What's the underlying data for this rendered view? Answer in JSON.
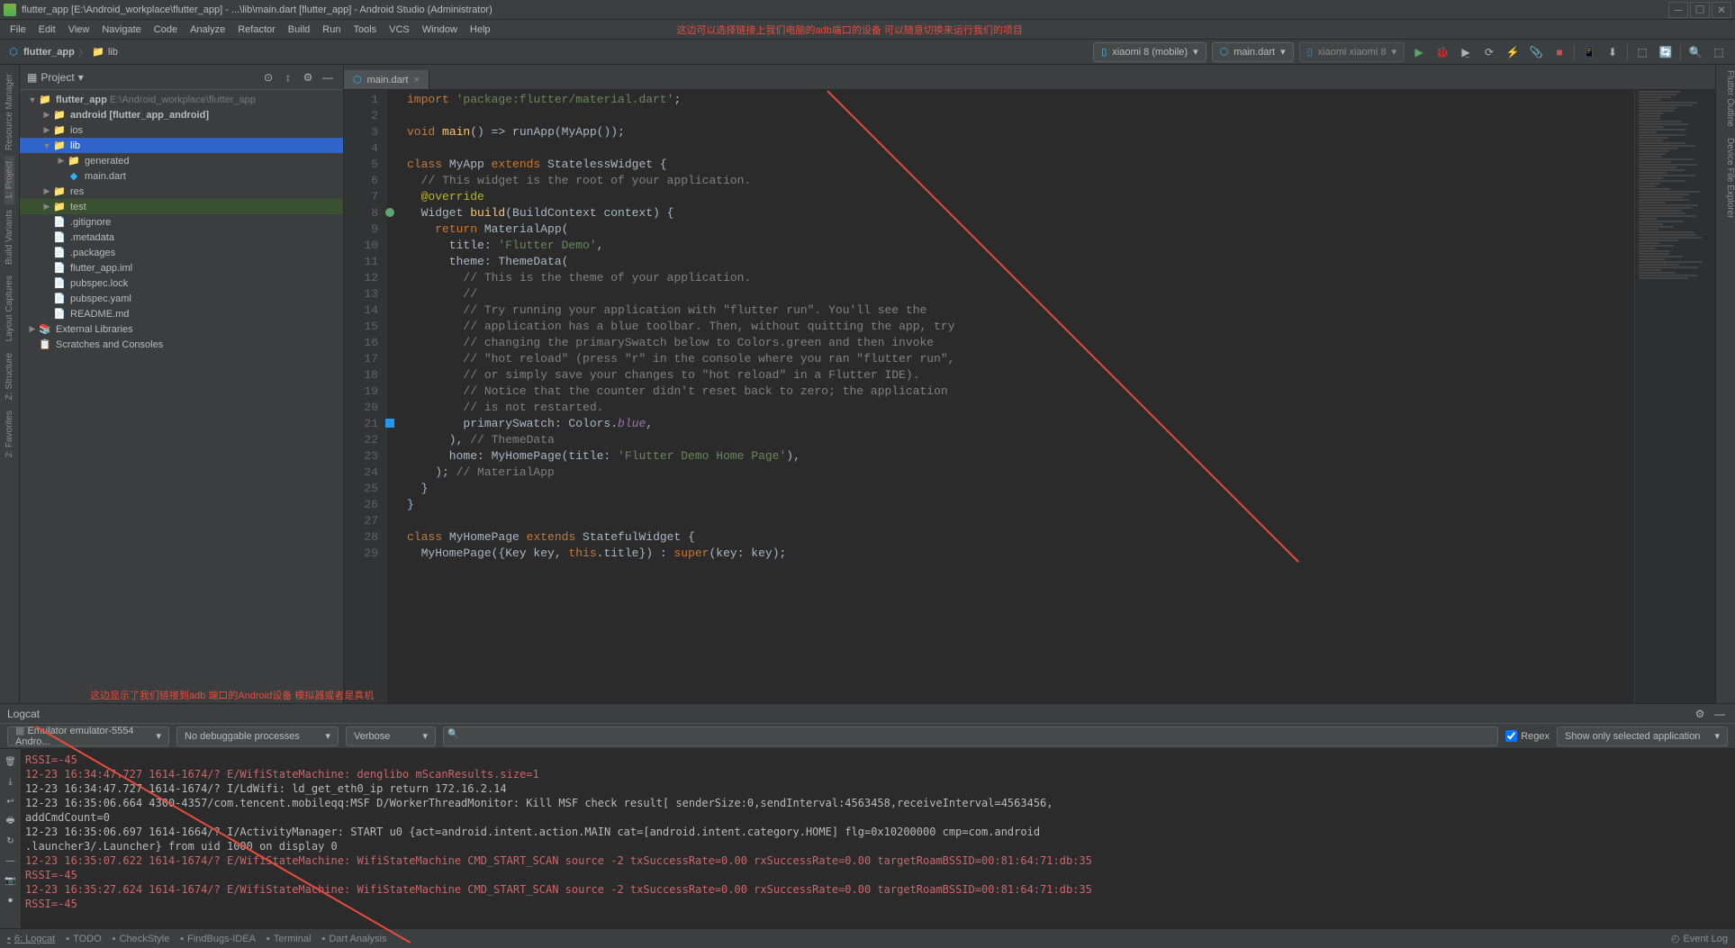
{
  "titlebar": {
    "text": "flutter_app [E:\\Android_workplace\\flutter_app] - ...\\lib\\main.dart [flutter_app] - Android Studio (Administrator)"
  },
  "menubar": {
    "items": [
      "File",
      "Edit",
      "View",
      "Navigate",
      "Code",
      "Analyze",
      "Refactor",
      "Build",
      "Run",
      "Tools",
      "VCS",
      "Window",
      "Help"
    ],
    "annotation": "这边可以选择链接上我们电脑的adb端口的设备 可以随意切换来运行我们的项目"
  },
  "breadcrumb": {
    "project": "flutter_app",
    "folder": "lib"
  },
  "toolbar": {
    "device": "xiaomi 8 (mobile)",
    "config": "main.dart",
    "device2": "xiaomi xiaomi 8"
  },
  "sidebar": {
    "title": "Project",
    "tree": [
      {
        "depth": 0,
        "arrow": "▼",
        "icon": "📁",
        "label": "flutter_app",
        "suffix": " E:\\Android_workplace\\flutter_app",
        "bold": true
      },
      {
        "depth": 1,
        "arrow": "▶",
        "icon": "📁",
        "label": "android [flutter_app_android]",
        "bold": true
      },
      {
        "depth": 1,
        "arrow": "▶",
        "icon": "📁",
        "label": "ios"
      },
      {
        "depth": 1,
        "arrow": "▼",
        "icon": "📁",
        "label": "lib",
        "selected": true
      },
      {
        "depth": 2,
        "arrow": "▶",
        "icon": "📁",
        "label": "generated"
      },
      {
        "depth": 2,
        "arrow": "",
        "icon": "◆",
        "label": "main.dart",
        "dart": true
      },
      {
        "depth": 1,
        "arrow": "▶",
        "icon": "📁",
        "label": "res"
      },
      {
        "depth": 1,
        "arrow": "▶",
        "icon": "📁",
        "label": "test",
        "hl": true
      },
      {
        "depth": 1,
        "arrow": "",
        "icon": "📄",
        "label": ".gitignore"
      },
      {
        "depth": 1,
        "arrow": "",
        "icon": "📄",
        "label": ".metadata"
      },
      {
        "depth": 1,
        "arrow": "",
        "icon": "📄",
        "label": ".packages"
      },
      {
        "depth": 1,
        "arrow": "",
        "icon": "📄",
        "label": "flutter_app.iml"
      },
      {
        "depth": 1,
        "arrow": "",
        "icon": "📄",
        "label": "pubspec.lock"
      },
      {
        "depth": 1,
        "arrow": "",
        "icon": "📄",
        "label": "pubspec.yaml"
      },
      {
        "depth": 1,
        "arrow": "",
        "icon": "📄",
        "label": "README.md"
      },
      {
        "depth": 0,
        "arrow": "▶",
        "icon": "📚",
        "label": "External Libraries"
      },
      {
        "depth": 0,
        "arrow": "",
        "icon": "📋",
        "label": "Scratches and Consoles"
      }
    ]
  },
  "left_rail": {
    "items": [
      "Resource Manager",
      "1: Project",
      "Build Variants",
      "Layout Captures",
      "Z: Structure",
      "2: Favorites"
    ]
  },
  "right_rail": {
    "items": [
      "Flutter Outline",
      "Device File Explorer"
    ]
  },
  "editor": {
    "tab": "main.dart",
    "lines": [
      {
        "n": 1,
        "html": "<span class='kw'>import</span> <span class='str'>'package:flutter/material.dart'</span>;"
      },
      {
        "n": 2,
        "html": ""
      },
      {
        "n": 3,
        "html": "<span class='kw'>void</span> <span class='fn'>main</span>() =&gt; runApp(MyApp());"
      },
      {
        "n": 4,
        "html": ""
      },
      {
        "n": 5,
        "html": "<span class='kw'>class</span> MyApp <span class='kw'>extends</span> StatelessWidget {"
      },
      {
        "n": 6,
        "html": "  <span class='cmt'>// This widget is the root of your application.</span>"
      },
      {
        "n": 7,
        "html": "  <span class='annot'>@override</span>"
      },
      {
        "n": 8,
        "html": "  Widget <span class='fn'>build</span>(BuildContext context) {",
        "mark": "run"
      },
      {
        "n": 9,
        "html": "    <span class='kw'>return</span> MaterialApp("
      },
      {
        "n": 10,
        "html": "      title: <span class='str'>'Flutter Demo'</span>,"
      },
      {
        "n": 11,
        "html": "      theme: ThemeData("
      },
      {
        "n": 12,
        "html": "        <span class='cmt'>// This is the theme of your application.</span>"
      },
      {
        "n": 13,
        "html": "        <span class='cmt'>//</span>"
      },
      {
        "n": 14,
        "html": "        <span class='cmt'>// Try running your application with \"flutter run\". You'll see the</span>"
      },
      {
        "n": 15,
        "html": "        <span class='cmt'>// application has a blue toolbar. Then, without quitting the app, try</span>"
      },
      {
        "n": 16,
        "html": "        <span class='cmt'>// changing the primarySwatch below to Colors.green and then invoke</span>"
      },
      {
        "n": 17,
        "html": "        <span class='cmt'>// \"hot reload\" (press \"r\" in the console where you ran \"flutter run\",</span>"
      },
      {
        "n": 18,
        "html": "        <span class='cmt'>// or simply save your changes to \"hot reload\" in a Flutter IDE).</span>"
      },
      {
        "n": 19,
        "html": "        <span class='cmt'>// Notice that the counter didn't reset back to zero; the application</span>"
      },
      {
        "n": 20,
        "html": "        <span class='cmt'>// is not restarted.</span>"
      },
      {
        "n": 21,
        "html": "        primarySwatch: Colors.<span class='it'>blue</span>,",
        "mark": "blue"
      },
      {
        "n": 22,
        "html": "      ), <span class='cmt'>// ThemeData</span>"
      },
      {
        "n": 23,
        "html": "      home: MyHomePage(title: <span class='str'>'Flutter Demo Home Page'</span>),"
      },
      {
        "n": 24,
        "html": "    ); <span class='cmt'>// MaterialApp</span>"
      },
      {
        "n": 25,
        "html": "  }"
      },
      {
        "n": 26,
        "html": "}"
      },
      {
        "n": 27,
        "html": ""
      },
      {
        "n": 28,
        "html": "<span class='kw'>class</span> MyHomePage <span class='kw'>extends</span> StatefulWidget {"
      },
      {
        "n": 29,
        "html": "  MyHomePage({Key key, <span class='kw'>this</span>.title}) : <span class='kw'>super</span>(key: key);"
      }
    ]
  },
  "logcat": {
    "title": "Logcat",
    "annotation": "这边显示了我们链接到adb 端口的Android设备 模拟器或者是真机",
    "device": "Emulator emulator-5554 Andro...",
    "process": "No debuggable processes",
    "level": "Verbose",
    "search_placeholder": "",
    "regex_label": "Regex",
    "filter": "Show only selected application",
    "lines": [
      {
        "cls": "log-err",
        "text": "   RSSI=-45"
      },
      {
        "cls": "log-err",
        "text": "12-23 16:34:47.727 1614-1674/? E/WifiStateMachine: denglibo mScanResults.size=1"
      },
      {
        "cls": "log-info",
        "text": "12-23 16:34:47.727 1614-1674/? I/LdWifi: ld_get_eth0_ip return 172.16.2.14"
      },
      {
        "cls": "log-info",
        "text": "12-23 16:35:06.664 4300-4357/com.tencent.mobileqq:MSF D/WorkerThreadMonitor: Kill MSF check result[ senderSize:0,sendInterval:4563458,receiveInterval=4563456,"
      },
      {
        "cls": "log-info",
        "text": "   addCmdCount=0"
      },
      {
        "cls": "log-info",
        "text": "12-23 16:35:06.697 1614-1664/? I/ActivityManager: START u0 {act=android.intent.action.MAIN cat=[android.intent.category.HOME] flg=0x10200000 cmp=com.android"
      },
      {
        "cls": "log-info",
        "text": "   .launcher3/.Launcher} from uid 1000 on display 0"
      },
      {
        "cls": "log-err",
        "text": "12-23 16:35:07.622 1614-1674/? E/WifiStateMachine: WifiStateMachine CMD_START_SCAN source -2 txSuccessRate=0.00 rxSuccessRate=0.00 targetRoamBSSID=00:81:64:71:db:35"
      },
      {
        "cls": "log-err",
        "text": "   RSSI=-45"
      },
      {
        "cls": "log-err",
        "text": "12-23 16:35:27.624 1614-1674/? E/WifiStateMachine: WifiStateMachine CMD_START_SCAN source -2 txSuccessRate=0.00 rxSuccessRate=0.00 targetRoamBSSID=00:81:64:71:db:35"
      },
      {
        "cls": "log-err",
        "text": "   RSSI=-45"
      }
    ]
  },
  "statusbar": {
    "items": [
      "6: Logcat",
      "TODO",
      "CheckStyle",
      "FindBugs-IDEA",
      "Terminal",
      "Dart Analysis"
    ],
    "right": "Event Log"
  }
}
